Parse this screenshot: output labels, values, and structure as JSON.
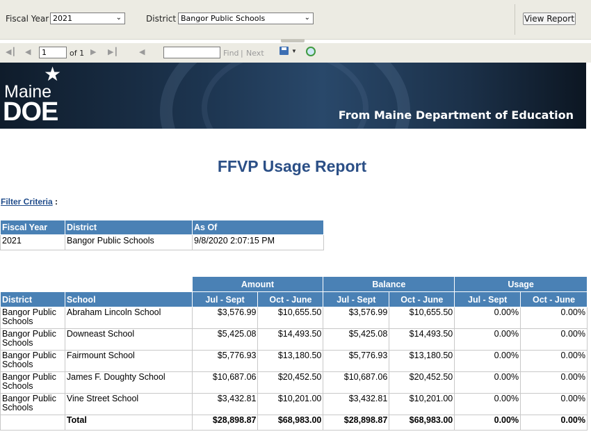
{
  "params": {
    "fiscal_year_label": "Fiscal Year",
    "fiscal_year_value": "2021",
    "district_label": "District",
    "district_value": "Bangor Public Schools",
    "view_report": "View Report"
  },
  "toolbar": {
    "page_value": "1",
    "of_label": "of 1",
    "find_label": "Find",
    "separator": "|",
    "next_label": "Next"
  },
  "banner": {
    "logo_top": "Maine",
    "logo_bottom": "DOE",
    "tagline": "From Maine Department of Education"
  },
  "report": {
    "title": "FFVP Usage Report",
    "filter_link": "Filter Criteria",
    "filter_colon": ":"
  },
  "filter_table": {
    "headers": [
      "Fiscal Year",
      "District",
      "As Of"
    ],
    "row": [
      "2021",
      "Bangor Public Schools",
      "9/8/2020 2:07:15 PM"
    ]
  },
  "main_table": {
    "groups": [
      "Amount",
      "Balance",
      "Usage"
    ],
    "col_district": "District",
    "col_school": "School",
    "subheaders": [
      "Jul - Sept",
      "Oct - June",
      "Jul - Sept",
      "Oct - June",
      "Jul - Sept",
      "Oct - June"
    ],
    "rows": [
      {
        "district": "Bangor Public Schools",
        "school": "Abraham Lincoln School",
        "vals": [
          "$3,576.99",
          "$10,655.50",
          "$3,576.99",
          "$10,655.50",
          "0.00%",
          "0.00%"
        ]
      },
      {
        "district": "Bangor Public Schools",
        "school": "Downeast School",
        "vals": [
          "$5,425.08",
          "$14,493.50",
          "$5,425.08",
          "$14,493.50",
          "0.00%",
          "0.00%"
        ]
      },
      {
        "district": "Bangor Public Schools",
        "school": "Fairmount School",
        "vals": [
          "$5,776.93",
          "$13,180.50",
          "$5,776.93",
          "$13,180.50",
          "0.00%",
          "0.00%"
        ]
      },
      {
        "district": "Bangor Public Schools",
        "school": "James F. Doughty School",
        "vals": [
          "$10,687.06",
          "$20,452.50",
          "$10,687.06",
          "$20,452.50",
          "0.00%",
          "0.00%"
        ]
      },
      {
        "district": "Bangor Public Schools",
        "school": "Vine Street School",
        "vals": [
          "$3,432.81",
          "$10,201.00",
          "$3,432.81",
          "$10,201.00",
          "0.00%",
          "0.00%"
        ]
      }
    ],
    "total": {
      "label": "Total",
      "vals": [
        "$28,898.87",
        "$68,983.00",
        "$28,898.87",
        "$68,983.00",
        "0.00%",
        "0.00%"
      ]
    }
  }
}
